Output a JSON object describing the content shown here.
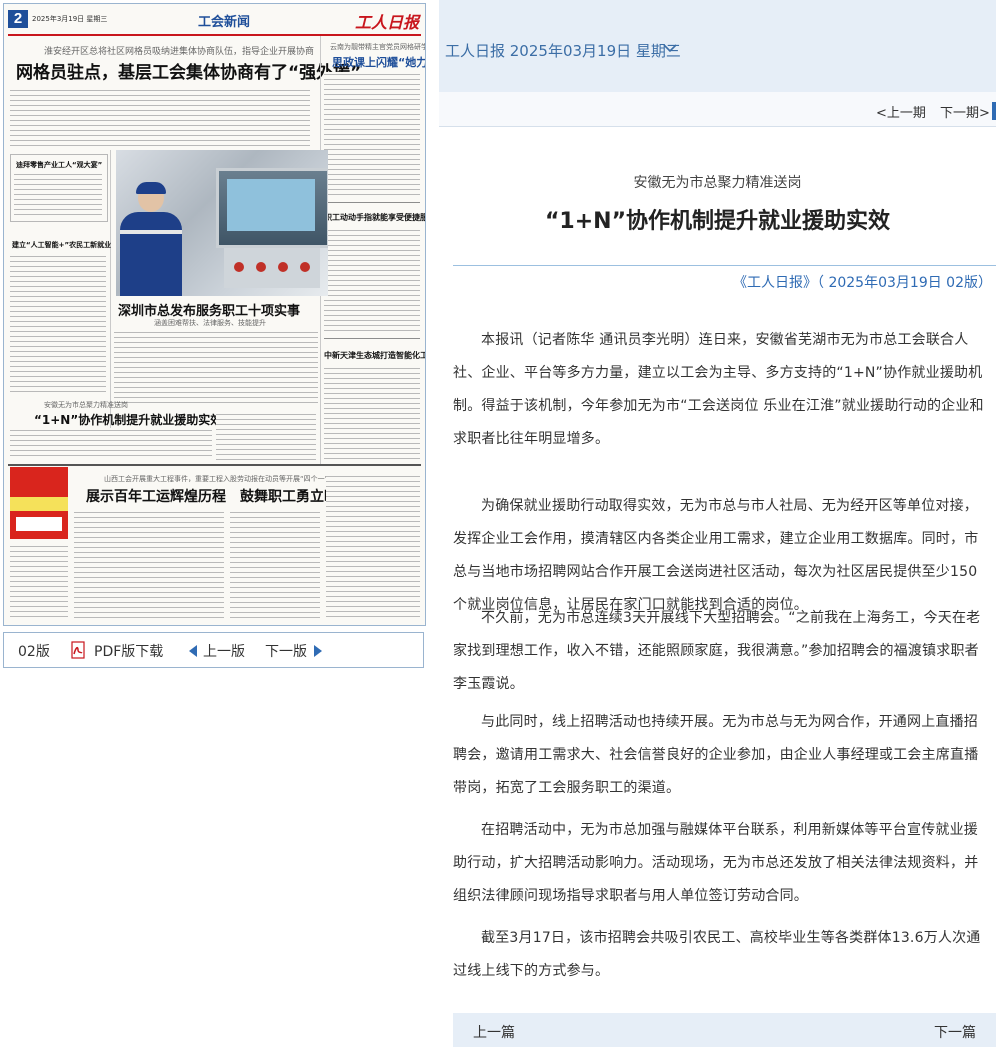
{
  "paper": {
    "page_number": "2",
    "date_line": "2025年3月19日 星期三",
    "section": "工会新闻",
    "masthead": "工人日报",
    "story1_sub": "淮安经开区总将社区网格员吸纳进集体协商队伍，指导企业开展协商",
    "story1_title": "网格员驻点，基层工会集体协商有了“强外援”",
    "story2_title": "职工动动手指就能享受便捷服务",
    "story3_sub": "云南为靓带精主官党员网格研学",
    "story3_title": "思政课上闪耀“她力量”",
    "story4_title": "深圳市总发布服务职工十项实事",
    "story4_sub": "涵盖困难帮扶、法律服务、技能提升",
    "story5_sub": "安徽无为市总聚力精准送岗",
    "story5_title": "“1+N”协作机制提升就业援助实效",
    "story6_title": "中新天津生态城打造智能化工会驿站",
    "story7_title": "建立“人工智能+”农民工新就业",
    "story8_title": "迪拜零售产业工人“观大宴”",
    "story9_sub": "山西工会开展重大工程事件，重要工程入股劳动报在动员等开展“四个一”工程——",
    "story9_title": "展示百年工运辉煌历程　鼓舞职工勇立时代潮头"
  },
  "pager": {
    "page_label": "02版",
    "pdf_label": "PDF版下载",
    "prev_label": "上一版",
    "next_label": "下一版"
  },
  "header": {
    "date_selector": "工人日报 2025年03月19日 星期三",
    "prev_issue": "<上一期",
    "next_issue": "下一期>"
  },
  "article": {
    "kicker": "安徽无为市总聚力精准送岗",
    "title": "“1+N”协作机制提升就业援助实效",
    "source": "《工人日报》（ 2025年03月19日 02版）",
    "paragraphs": [
      "本报讯（记者陈华 通讯员李光明）连日来，安徽省芜湖市无为市总工会联合人社、企业、平台等多方力量，建立以工会为主导、多方支持的“1+N”协作就业援助机制。得益于该机制，今年参加无为市“工会送岗位 乐业在江淮”就业援助行动的企业和求职者比往年明显增多。",
      "为确保就业援助行动取得实效，无为市总与市人社局、无为经开区等单位对接，发挥企业工会作用，摸清辖区内各类企业用工需求，建立企业用工数据库。同时，市总与当地市场招聘网站合作开展工会送岗进社区活动，每次为社区居民提供至少150个就业岗位信息，让居民在家门口就能找到合适的岗位。",
      "不久前，无为市总连续3天开展线下大型招聘会。“之前我在上海务工，今天在老家找到理想工作，收入不错，还能照顾家庭，我很满意。”参加招聘会的福渡镇求职者李玉霞说。",
      "与此同时，线上招聘活动也持续开展。无为市总与无为网合作，开通网上直播招聘会，邀请用工需求大、社会信誉良好的企业参加，由企业人事经理或工会主席直播带岗，拓宽了工会服务职工的渠道。",
      "在招聘活动中，无为市总加强与融媒体平台联系，利用新媒体等平台宣传就业援助行动，扩大招聘活动影响力。活动现场，无为市总还发放了相关法律法规资料，并组织法律顾问现场指导求职者与用人单位签订劳动合同。",
      "截至3月17日，该市招聘会共吸引农民工、高校毕业生等各类群体13.6万人次通过线上线下的方式参与。"
    ]
  },
  "footer": {
    "prev_article": "上一篇",
    "next_article": "下一篇"
  },
  "colors": {
    "accent_blue": "#2f6bb4",
    "masthead_red": "#c8161d",
    "bar_bg": "#e6eef7"
  }
}
